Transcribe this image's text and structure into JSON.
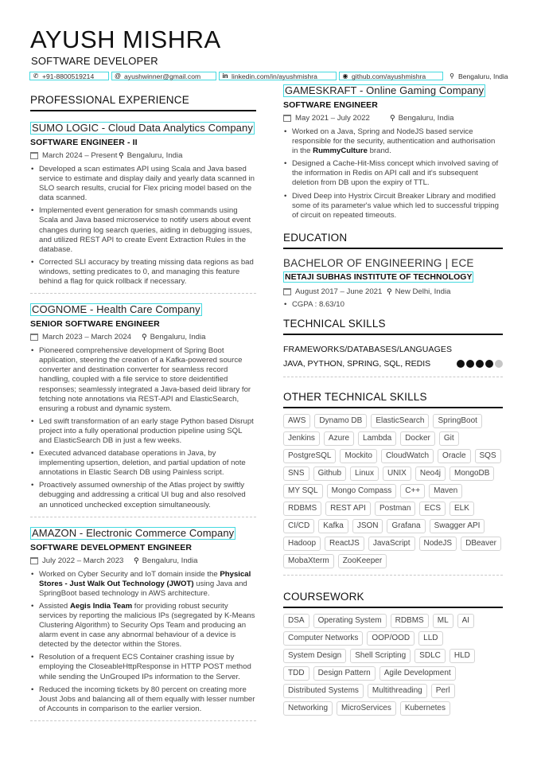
{
  "header": {
    "name": "AYUSH MISHRA",
    "title": "SOFTWARE DEVELOPER",
    "contacts": {
      "phone": "+91-8800519214",
      "email": "ayushwinner@gmail.com",
      "linkedin": "linkedin.com/in/ayushmishra",
      "github": "github.com/ayushmishra",
      "location": "Bengaluru, India"
    },
    "icons": {
      "phone": "phone-icon",
      "email": "at-icon",
      "linkedin": "linkedin-icon",
      "github": "github-icon",
      "location": "map-pin-icon"
    }
  },
  "experience": {
    "heading": "PROFESSIONAL EXPERIENCE",
    "jobs": [
      {
        "company": "SUMO LOGIC - Cloud Data Analytics Company",
        "title": "SOFTWARE ENGINEER - II",
        "dates": "March 2024 – Present",
        "location": "Bengaluru, India",
        "bullets": [
          "Developed a scan estimates API using Scala and Java based service to estimate and display daily and yearly data scanned in SLO search results, crucial for Flex pricing model based on the data scanned.",
          "Implemented event generation for smash commands using Scala and Java based microservice to notify users about event changes during log search queries, aiding in debugging issues, and utilized REST API to create Event Extraction Rules in the database.",
          "Corrected SLI accuracy by treating missing data regions as bad windows, setting predicates to 0, and managing this feature behind a flag for quick rollback if necessary."
        ]
      },
      {
        "company": "COGNOME - Health Care Company",
        "title": "SENIOR SOFTWARE ENGINEER",
        "dates": "March 2023 – March 2024",
        "location": "Bengaluru, India",
        "bullets": [
          "Pioneered comprehensive development of Spring Boot application, steering the creation of a Kafka-powered source converter and destination converter for seamless record handling, coupled with a file service to store deidentified responses; seamlessly integrated a Java-based deid library for fetching note annotations via REST-API and ElasticSearch, ensuring a robust and dynamic system.",
          "Led swift transformation of an early stage Python based Disrupt project into a fully operational production pipeline using SQL and ElasticSearch DB in just a few weeks.",
          "Executed advanced database operations in Java, by implementing upsertion, deletion, and partial updation of note annotations in Elastic Search DB using Painless script.",
          "Proactively assumed ownership of the Atlas project by swiftly debugging and addressing a critical UI bug and also resolved an unnoticed unchecked exception simultaneously."
        ]
      },
      {
        "company": "AMAZON - Electronic Commerce Company",
        "title": "SOFTWARE DEVELOPMENT ENGINEER",
        "dates": "July 2022 – March 2023",
        "location": "Bengaluru, India",
        "bullets": [
          {
            "pre": "Worked on Cyber Security and IoT domain inside the ",
            "bold": "Physical Stores - Just Walk Out Technology (JWOT)",
            "post": " using Java and SpringBoot based technology in AWS architecture."
          },
          {
            "pre": "Assisted ",
            "bold": "Aegis India Team",
            "post": " for providing robust security services by reporting the malicious IPs (segregated by K-Means Clustering Algorithm) to Security Ops Team and producing an alarm event in case any abnormal behaviour of a device is detected by the detector within the Stores."
          },
          "Resolution of a frequent ECS Container crashing issue by employing the CloseableHttpResponse in HTTP POST method while sending the UnGrouped IPs information to the Server.",
          "Reduced the incoming tickets by 80 percent on creating more Joust Jobs and balancing all of them equally with lesser number of Accounts in comparison to the earlier version."
        ]
      },
      {
        "company": "GAMESKRAFT - Online Gaming Company",
        "title": "SOFTWARE ENGINEER",
        "dates": "May 2021 – July 2022",
        "location": "Bengaluru, India",
        "bullets": [
          {
            "pre": "Worked on a Java, Spring and NodeJS based service responsible for the security, authentication and authorisation in the ",
            "bold": "RummyCulture",
            "post": " brand."
          },
          "Designed a Cache-Hit-Miss concept which involved saving of the information in Redis on API call and it's subsequent deletion from DB upon the expiry of TTL.",
          "Dived Deep into Hystrix Circuit Breaker Library and modified some of its parameter's value which led to successful tripping of circuit on repeated timeouts."
        ]
      }
    ]
  },
  "education": {
    "heading": "EDUCATION",
    "degree": "BACHELOR OF ENGINEERING | ECE",
    "school": "NETAJI SUBHAS INSTITUTE OF TECHNOLOGY",
    "dates": "August 2017 – June 2021",
    "location": "New Delhi, India",
    "bullets": [
      "CGPA : 8.63/10"
    ]
  },
  "technical_skills": {
    "heading": "TECHNICAL SKILLS",
    "category": "FRAMEWORKS/DATABASES/LANGUAGES",
    "skills": "JAVA, PYTHON, SPRING, SQL, REDIS",
    "rating": 4,
    "rating_max": 5
  },
  "other_skills": {
    "heading": "OTHER TECHNICAL SKILLS",
    "tags": [
      "AWS",
      "Dynamo DB",
      "ElasticSearch",
      "SpringBoot",
      "Jenkins",
      "Azure",
      "Lambda",
      "Docker",
      "Git",
      "PostgreSQL",
      "Mockito",
      "CloudWatch",
      "Oracle",
      "SQS",
      "SNS",
      "Github",
      "Linux",
      "UNIX",
      "Neo4j",
      "MongoDB",
      "MY SQL",
      "Mongo Compass",
      "C++",
      "Maven",
      "RDBMS",
      "REST API",
      "Postman",
      "ECS",
      "ELK",
      "CI/CD",
      "Kafka",
      "JSON",
      "Grafana",
      "Swagger API",
      "Hadoop",
      "ReactJS",
      "JavaScript",
      "NodeJS",
      "DBeaver",
      "MobaXterm",
      "ZooKeeper"
    ]
  },
  "coursework": {
    "heading": "COURSEWORK",
    "tags": [
      "DSA",
      "Operating System",
      "RDBMS",
      "ML",
      "AI",
      "Computer Networks",
      "OOP/OOD",
      "LLD",
      "System Design",
      "Shell Scripting",
      "SDLC",
      "HLD",
      "TDD",
      "Design Pattern",
      "Agile Development",
      "Distributed Systems",
      "Multithreading",
      "Perl",
      "Networking",
      "MicroServices",
      "Kubernetes"
    ]
  }
}
